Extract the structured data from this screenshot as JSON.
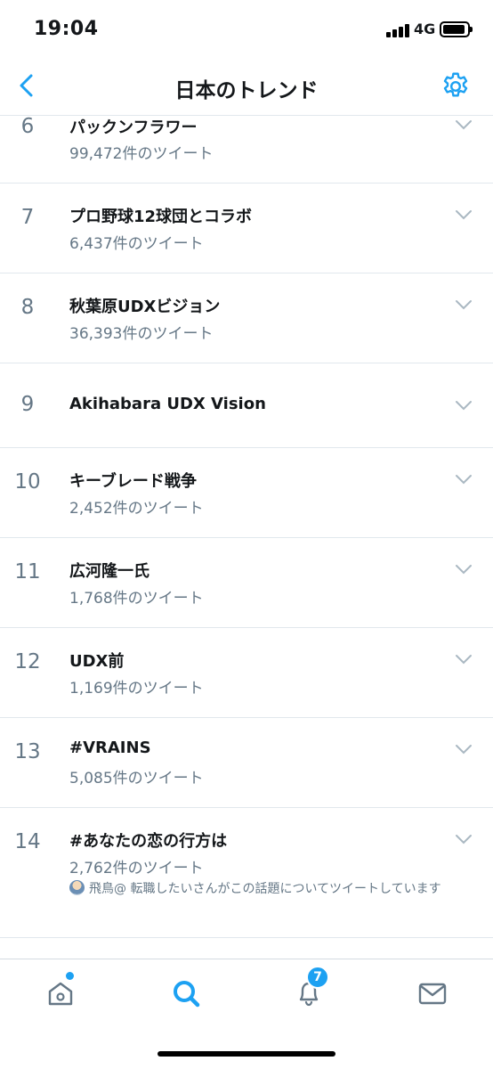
{
  "status_bar": {
    "time": "19:04",
    "network": "4G"
  },
  "nav": {
    "title": "日本のトレンド",
    "back_icon": "chevron-left-icon",
    "settings_icon": "gear-icon"
  },
  "trends": [
    {
      "rank": "6",
      "name": "パックンフラワー",
      "count": "99,472件のツイート"
    },
    {
      "rank": "7",
      "name": "プロ野球12球団とコラボ",
      "count": "6,437件のツイート"
    },
    {
      "rank": "8",
      "name": "秋葉原UDXビジョン",
      "count": "36,393件のツイート"
    },
    {
      "rank": "9",
      "name": "Akihabara UDX Vision",
      "count": ""
    },
    {
      "rank": "10",
      "name": "キーブレード戦争",
      "count": "2,452件のツイート"
    },
    {
      "rank": "11",
      "name": "広河隆一氏",
      "count": "1,768件のツイート"
    },
    {
      "rank": "12",
      "name": "UDX前",
      "count": "1,169件のツイート"
    },
    {
      "rank": "13",
      "name": "#VRAINS",
      "count": "5,085件のツイート"
    },
    {
      "rank": "14",
      "name": "#あなたの恋の行方は",
      "count": "2,762件のツイート",
      "context": "飛鳥@ 転職したいさんがこの話題についてツイートしています"
    }
  ],
  "tab_bar": {
    "tabs": [
      {
        "name": "home",
        "icon": "home-icon"
      },
      {
        "name": "search",
        "icon": "search-icon"
      },
      {
        "name": "notifications",
        "icon": "bell-icon",
        "badge": "7"
      },
      {
        "name": "messages",
        "icon": "envelope-icon"
      }
    ]
  },
  "colors": {
    "accent": "#1da1f2",
    "text": "#14171a",
    "secondary": "#657786",
    "divider": "#e1e8ed"
  }
}
